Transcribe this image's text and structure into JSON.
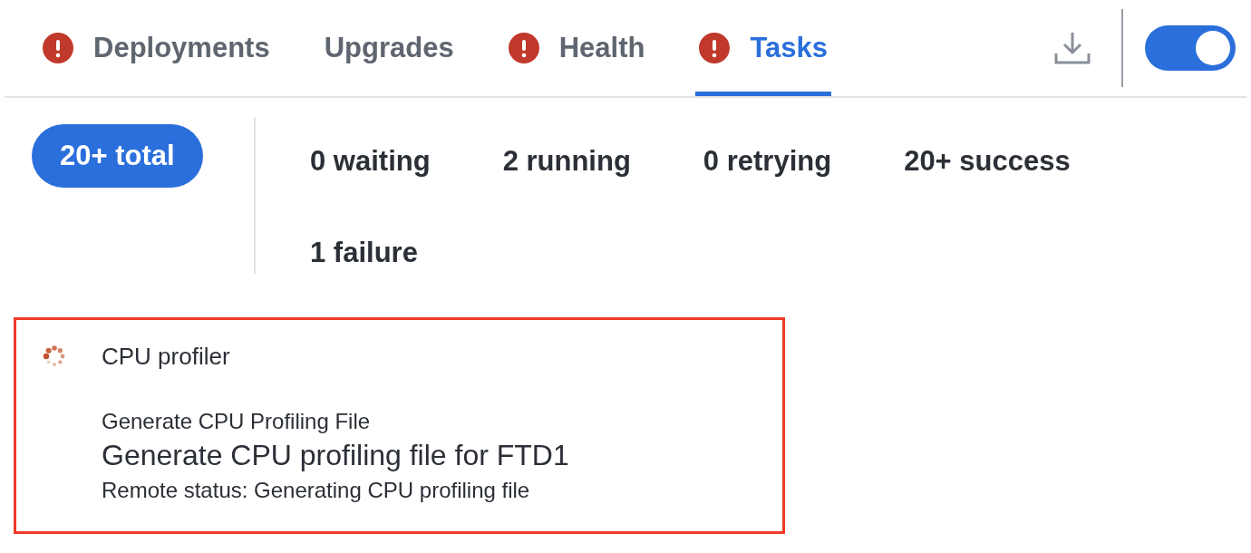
{
  "tabs": [
    {
      "label": "Deployments",
      "alert": true,
      "selected": false
    },
    {
      "label": "Upgrades",
      "alert": false,
      "selected": false
    },
    {
      "label": "Health",
      "alert": true,
      "selected": false
    },
    {
      "label": "Tasks",
      "alert": true,
      "selected": true
    }
  ],
  "toggle": {
    "on": true
  },
  "filters": [
    {
      "label": "20+ total",
      "selected": true
    },
    {
      "label": "0 waiting",
      "selected": false
    },
    {
      "label": "2 running",
      "selected": false
    },
    {
      "label": "0 retrying",
      "selected": false
    },
    {
      "label": "20+ success",
      "selected": false
    },
    {
      "label": "1 failure",
      "selected": false
    }
  ],
  "tasks": [
    {
      "in_progress": true,
      "highlighted": true,
      "name": "CPU profiler",
      "action": "Generate CPU Profiling File",
      "description": "Generate CPU profiling file for FTD1",
      "remote_status": "Remote status: Generating CPU profiling file"
    }
  ]
}
